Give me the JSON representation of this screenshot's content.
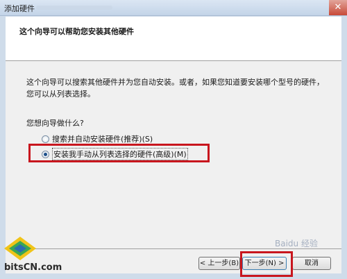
{
  "window": {
    "title": "添加硬件",
    "close_glyph": "✕"
  },
  "header": {
    "title": "这个向导可以帮助您安装其他硬件"
  },
  "content": {
    "description": "这个向导可以搜索其他硬件并为您自动安装。或者，如果您知道要安装哪个型号的硬件，您可以从列表选择。",
    "question": "您想向导做什么?",
    "options": [
      {
        "label": "搜索并自动安装硬件(推荐)(S)",
        "checked": false
      },
      {
        "label": "安装我手动从列表选择的硬件(高级)(M)",
        "checked": true
      }
    ]
  },
  "buttons": {
    "back": "< 上一步(B)",
    "next": "下一步(N) >",
    "cancel": "取消"
  },
  "logo": {
    "text": "bitsCN.com"
  },
  "watermark": {
    "text": "Baidu 经验"
  },
  "colors": {
    "highlight": "#c8161e",
    "titlebar": "#c3d4e8"
  }
}
